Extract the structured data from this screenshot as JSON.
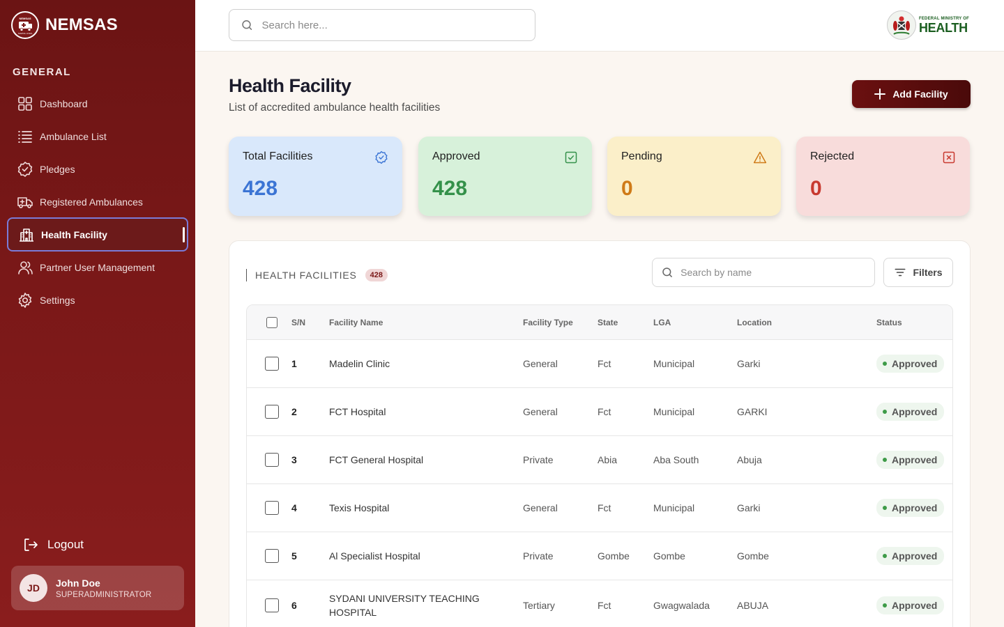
{
  "brand": {
    "name": "NEMSAS",
    "logo_text_top": "NEMSAS",
    "logo_text_bottom": "SAVING LIVES"
  },
  "sidebar": {
    "section_label": "GENERAL",
    "items": [
      {
        "label": "Dashboard",
        "icon": "grid-icon",
        "active": false
      },
      {
        "label": "Ambulance List",
        "icon": "list-icon",
        "active": false
      },
      {
        "label": "Pledges",
        "icon": "badge-check-icon",
        "active": false
      },
      {
        "label": "Registered Ambulances",
        "icon": "ambulance-icon",
        "active": false
      },
      {
        "label": "Health Facility",
        "icon": "hospital-icon",
        "active": true
      },
      {
        "label": "Partner User Management",
        "icon": "users-icon",
        "active": false
      },
      {
        "label": "Settings",
        "icon": "gear-icon",
        "active": false
      }
    ],
    "logout_label": "Logout",
    "user": {
      "initials": "JD",
      "name": "John Doe",
      "role": "SUPERADMINISTRATOR"
    }
  },
  "header": {
    "search_placeholder": "Search here...",
    "ministry_small": "FEDERAL MINISTRY OF",
    "ministry_big": "HEALTH"
  },
  "page": {
    "title": "Health Facility",
    "subtitle": "List of accredited ambulance health facilities",
    "add_button_label": "Add Facility"
  },
  "stats": [
    {
      "label": "Total Facilities",
      "value": "428",
      "icon": "verified-icon",
      "accent": "#3b74d4",
      "bg": "#d9e8fb"
    },
    {
      "label": "Approved",
      "value": "428",
      "icon": "check-square-icon",
      "accent": "#34914a",
      "bg": "#d7f1da"
    },
    {
      "label": "Pending",
      "value": "0",
      "icon": "warning-icon",
      "accent": "#cf7a17",
      "bg": "#fbefc9"
    },
    {
      "label": "Rejected",
      "value": "0",
      "icon": "x-square-icon",
      "accent": "#c8392f",
      "bg": "#f8dcdb"
    }
  ],
  "table": {
    "title": "HEALTH FACILITIES",
    "count": "428",
    "search_placeholder": "Search by name",
    "filters_label": "Filters",
    "columns": [
      "S/N",
      "Facility Name",
      "Facility Type",
      "State",
      "LGA",
      "Location",
      "Status"
    ],
    "rows": [
      {
        "sn": "1",
        "name": "Madelin Clinic",
        "type": "General",
        "state": "Fct",
        "lga": "Municipal",
        "location": "Garki",
        "status": "Approved"
      },
      {
        "sn": "2",
        "name": "FCT Hospital",
        "type": "General",
        "state": "Fct",
        "lga": "Municipal",
        "location": "GARKI",
        "status": "Approved"
      },
      {
        "sn": "3",
        "name": "FCT General Hospital",
        "type": "Private",
        "state": "Abia",
        "lga": "Aba South",
        "location": "Abuja",
        "status": "Approved"
      },
      {
        "sn": "4",
        "name": "Texis Hospital",
        "type": "General",
        "state": "Fct",
        "lga": "Municipal",
        "location": "Garki",
        "status": "Approved"
      },
      {
        "sn": "5",
        "name": "Al Specialist Hospital",
        "type": "Private",
        "state": "Gombe",
        "lga": "Gombe",
        "location": "Gombe",
        "status": "Approved"
      },
      {
        "sn": "6",
        "name": "SYDANI UNIVERSITY TEACHING HOSPITAL",
        "type": "Tertiary",
        "state": "Fct",
        "lga": "Gwagwalada",
        "location": "ABUJA",
        "status": "Approved"
      }
    ]
  }
}
